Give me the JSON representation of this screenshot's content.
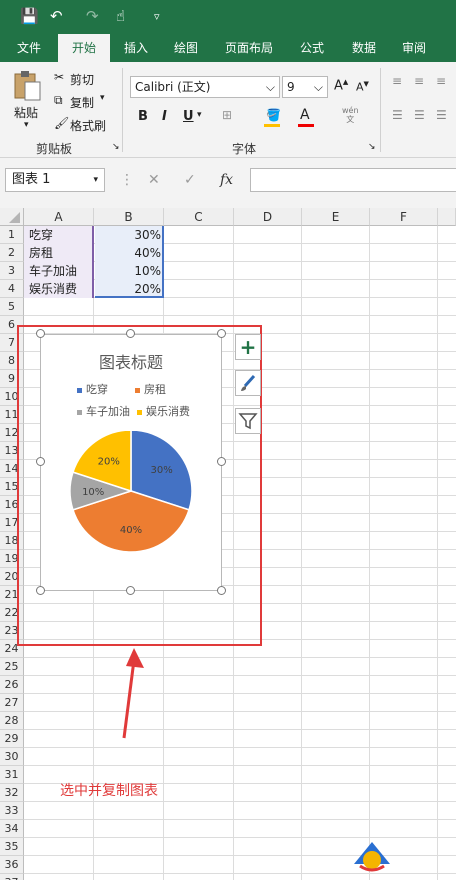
{
  "ribbon_tabs": [
    "文件",
    "开始",
    "插入",
    "绘图",
    "页面布局",
    "公式",
    "数据",
    "审阅"
  ],
  "active_tab": "开始",
  "clipboard": {
    "paste": "粘贴",
    "cut": "剪切",
    "copy": "复制",
    "format_painter": "格式刷",
    "group": "剪贴板"
  },
  "font": {
    "name": "Calibri (正文)",
    "size": "9",
    "group": "字体",
    "wen": "wén",
    "wen_sub": "文",
    "bold": "B",
    "italic": "I",
    "underline": "U"
  },
  "name_box": "图表 1",
  "fx": "fx",
  "columns": [
    "A",
    "B",
    "C",
    "D",
    "E",
    "F"
  ],
  "rows": [
    "1",
    "2",
    "3",
    "4",
    "5",
    "6",
    "7",
    "8",
    "9",
    "10",
    "11",
    "12",
    "13",
    "14",
    "15",
    "16",
    "17",
    "18",
    "19",
    "20",
    "21",
    "22",
    "23",
    "24",
    "25",
    "26",
    "27",
    "28",
    "29",
    "30",
    "31",
    "32",
    "33",
    "34",
    "35",
    "36",
    "37"
  ],
  "table": [
    {
      "a": "吃穿",
      "b": "30%"
    },
    {
      "a": "房租",
      "b": "40%"
    },
    {
      "a": "车子加油",
      "b": "10%"
    },
    {
      "a": "娱乐消费",
      "b": "20%"
    }
  ],
  "chart": {
    "title": "图表标题",
    "legend": [
      "吃穿",
      "房租",
      "车子加油",
      "娱乐消费"
    ],
    "labels": [
      "30%",
      "40%",
      "10%",
      "20%"
    ]
  },
  "chart_data": {
    "type": "pie",
    "title": "图表标题",
    "categories": [
      "吃穿",
      "房租",
      "车子加油",
      "娱乐消费"
    ],
    "values": [
      30,
      40,
      10,
      20
    ],
    "colors": [
      "#4472c4",
      "#ed7d31",
      "#a5a5a5",
      "#ffc000"
    ],
    "legend": "top"
  },
  "caption": "选中并复制图表"
}
